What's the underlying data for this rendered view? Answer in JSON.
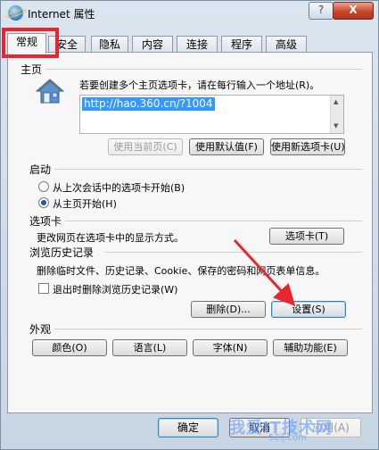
{
  "window": {
    "title": "Internet 属性",
    "help_label": "?",
    "close_label": "X"
  },
  "tabs": [
    {
      "label": "常规",
      "active": true
    },
    {
      "label": "安全"
    },
    {
      "label": "隐私"
    },
    {
      "label": "内容"
    },
    {
      "label": "连接"
    },
    {
      "label": "程序"
    },
    {
      "label": "高级"
    }
  ],
  "home": {
    "section_label": "主页",
    "instruction": "若要创建多个主页选项卡，请在每行输入一个地址(R)。",
    "url": "http://hao.360.cn/?1004",
    "btn_use_current": "使用当前页(C)",
    "btn_use_default": "使用默认值(F)",
    "btn_use_new_tab": "使用新选项卡(U)"
  },
  "startup": {
    "section_label": "启动",
    "option_last_session": "从上次会话中的选项卡开始(B)",
    "option_home": "从主页开始(H)"
  },
  "tabs_section": {
    "section_label": "选项卡",
    "description": "更改网页在选项卡中的显示方式。",
    "btn_tabs": "选项卡(T)"
  },
  "history": {
    "section_label": "浏览历史记录",
    "description": "删除临时文件、历史记录、Cookie、保存的密码和网页表单信息。",
    "checkbox_label": "退出时删除浏览历史记录(W)",
    "btn_delete": "删除(D)...",
    "btn_settings": "设置(S)"
  },
  "appearance": {
    "section_label": "外观",
    "btn_colors": "颜色(O)",
    "btn_languages": "语言(L)",
    "btn_fonts": "字体(N)",
    "btn_accessibility": "辅助功能(E)"
  },
  "footer": {
    "btn_ok": "确定",
    "btn_cancel": "取消",
    "btn_apply": "应用(A)"
  },
  "watermark": {
    "text": "我爱IT技术网",
    "sub": "52ij.com"
  },
  "colors": {
    "highlight_red": "#e8262b",
    "selection_blue": "#3399ff"
  }
}
